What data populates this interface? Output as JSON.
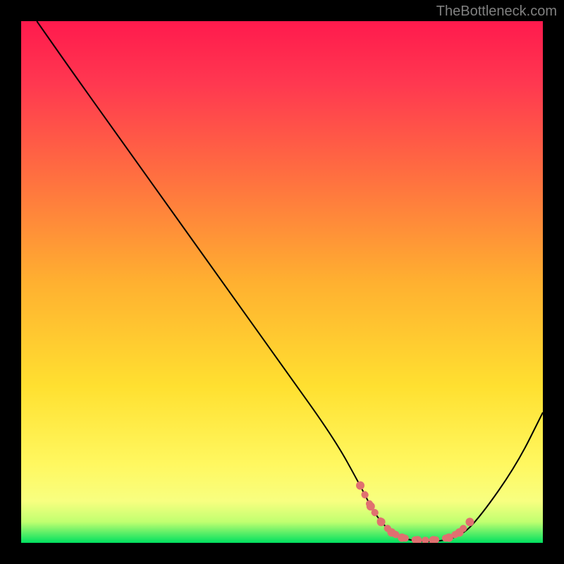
{
  "attribution": "TheBottleneck.com",
  "chart_data": {
    "type": "line",
    "title": "",
    "xlabel": "",
    "ylabel": "",
    "x_range": [
      0,
      100
    ],
    "y_range": [
      0,
      100
    ],
    "curve": {
      "description": "Bottleneck percentage curve descending from top-left to a minimum valley on the right side, then rising",
      "points": [
        {
          "x": 3,
          "y": 100
        },
        {
          "x": 10,
          "y": 90
        },
        {
          "x": 20,
          "y": 76
        },
        {
          "x": 30,
          "y": 62
        },
        {
          "x": 40,
          "y": 48
        },
        {
          "x": 50,
          "y": 34
        },
        {
          "x": 60,
          "y": 20
        },
        {
          "x": 65,
          "y": 11
        },
        {
          "x": 68,
          "y": 5
        },
        {
          "x": 72,
          "y": 1
        },
        {
          "x": 78,
          "y": 0
        },
        {
          "x": 84,
          "y": 1
        },
        {
          "x": 88,
          "y": 5
        },
        {
          "x": 95,
          "y": 15
        },
        {
          "x": 100,
          "y": 25
        }
      ]
    },
    "highlight_segment": {
      "description": "Pink/salmon thick dotted segment marking the optimal (low bottleneck) region at the bottom of the valley",
      "color": "#e07070",
      "points": [
        {
          "x": 65,
          "y": 11
        },
        {
          "x": 67,
          "y": 7
        },
        {
          "x": 69,
          "y": 4
        },
        {
          "x": 71,
          "y": 2
        },
        {
          "x": 73,
          "y": 1
        },
        {
          "x": 76,
          "y": 0.5
        },
        {
          "x": 79,
          "y": 0.5
        },
        {
          "x": 82,
          "y": 1
        },
        {
          "x": 84,
          "y": 2
        },
        {
          "x": 86,
          "y": 4
        }
      ]
    },
    "background_gradient": {
      "description": "Vertical gradient red (top) to green (bottom) representing bottleneck severity",
      "stops": [
        {
          "offset": 0,
          "color": "#ff1a4d"
        },
        {
          "offset": 0.12,
          "color": "#ff3850"
        },
        {
          "offset": 0.3,
          "color": "#ff7040"
        },
        {
          "offset": 0.5,
          "color": "#ffb030"
        },
        {
          "offset": 0.7,
          "color": "#ffe030"
        },
        {
          "offset": 0.85,
          "color": "#fff860"
        },
        {
          "offset": 0.92,
          "color": "#f8ff80"
        },
        {
          "offset": 0.96,
          "color": "#c0ff70"
        },
        {
          "offset": 1.0,
          "color": "#00e060"
        }
      ]
    }
  }
}
